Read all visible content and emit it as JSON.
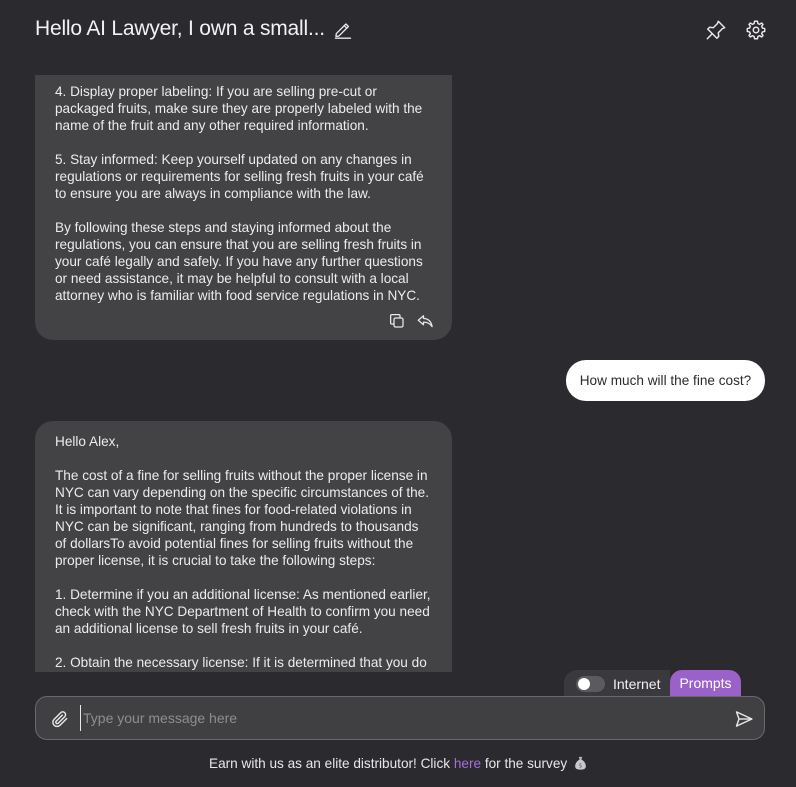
{
  "header": {
    "title": "Hello AI Lawyer, I own a small...",
    "icons": {
      "edit": "pencil-edit-icon",
      "pin": "pin-icon",
      "settings": "gear-icon"
    }
  },
  "messages": {
    "ai_1": {
      "paragraphs": [
        "4. Display proper labeling: If you are selling pre-cut or packaged fruits, make sure they are properly labeled with the name of the fruit and any other required information.",
        "5. Stay informed: Keep yourself updated on any changes in regulations or requirements for selling fresh fruits in your café to ensure you are always in compliance with the law.",
        "By following these steps and staying informed about the regulations, you can ensure that you are selling fresh fruits in your café legally and safely. If you have any further questions or need assistance, it may be helpful to consult with a local attorney who is familiar with food service regulations in NYC."
      ],
      "actions": [
        "copy-icon",
        "reply-icon"
      ]
    },
    "user_1": {
      "text": "How much will the fine cost?"
    },
    "ai_2": {
      "paragraphs": [
        "Hello Alex,",
        "The cost of a fine for selling fruits without the proper license in NYC can vary depending on the specific circumstances of the. It is important to note that fines for food-related violations in NYC can be significant, ranging from hundreds to thousands of dollarsTo avoid potential fines for selling fruits without the proper license, it is crucial to take the following steps:",
        "1. Determine if you an additional license: As mentioned earlier, check with the NYC Department of Health to confirm you need an additional license to sell fresh fruits in your café.",
        "2. Obtain the necessary license: If it is determined that you do"
      ]
    }
  },
  "controls": {
    "internet_label": "Internet",
    "internet_enabled": false,
    "prompts_label": "Prompts"
  },
  "composer": {
    "placeholder": "Type your message here",
    "value": "",
    "icons": {
      "attach": "paperclip-icon",
      "send": "send-icon"
    }
  },
  "footer": {
    "prefix": "Earn with us as an elite distributor! Click ",
    "link_text": "here",
    "suffix": " for the survey",
    "emoji_icon": "money-bag-icon"
  },
  "colors": {
    "background": "#2b2a2e",
    "ai_bubble": "#434346",
    "user_bubble": "#ffffff",
    "accent": "#9a62c9",
    "link": "#a66fd6"
  }
}
